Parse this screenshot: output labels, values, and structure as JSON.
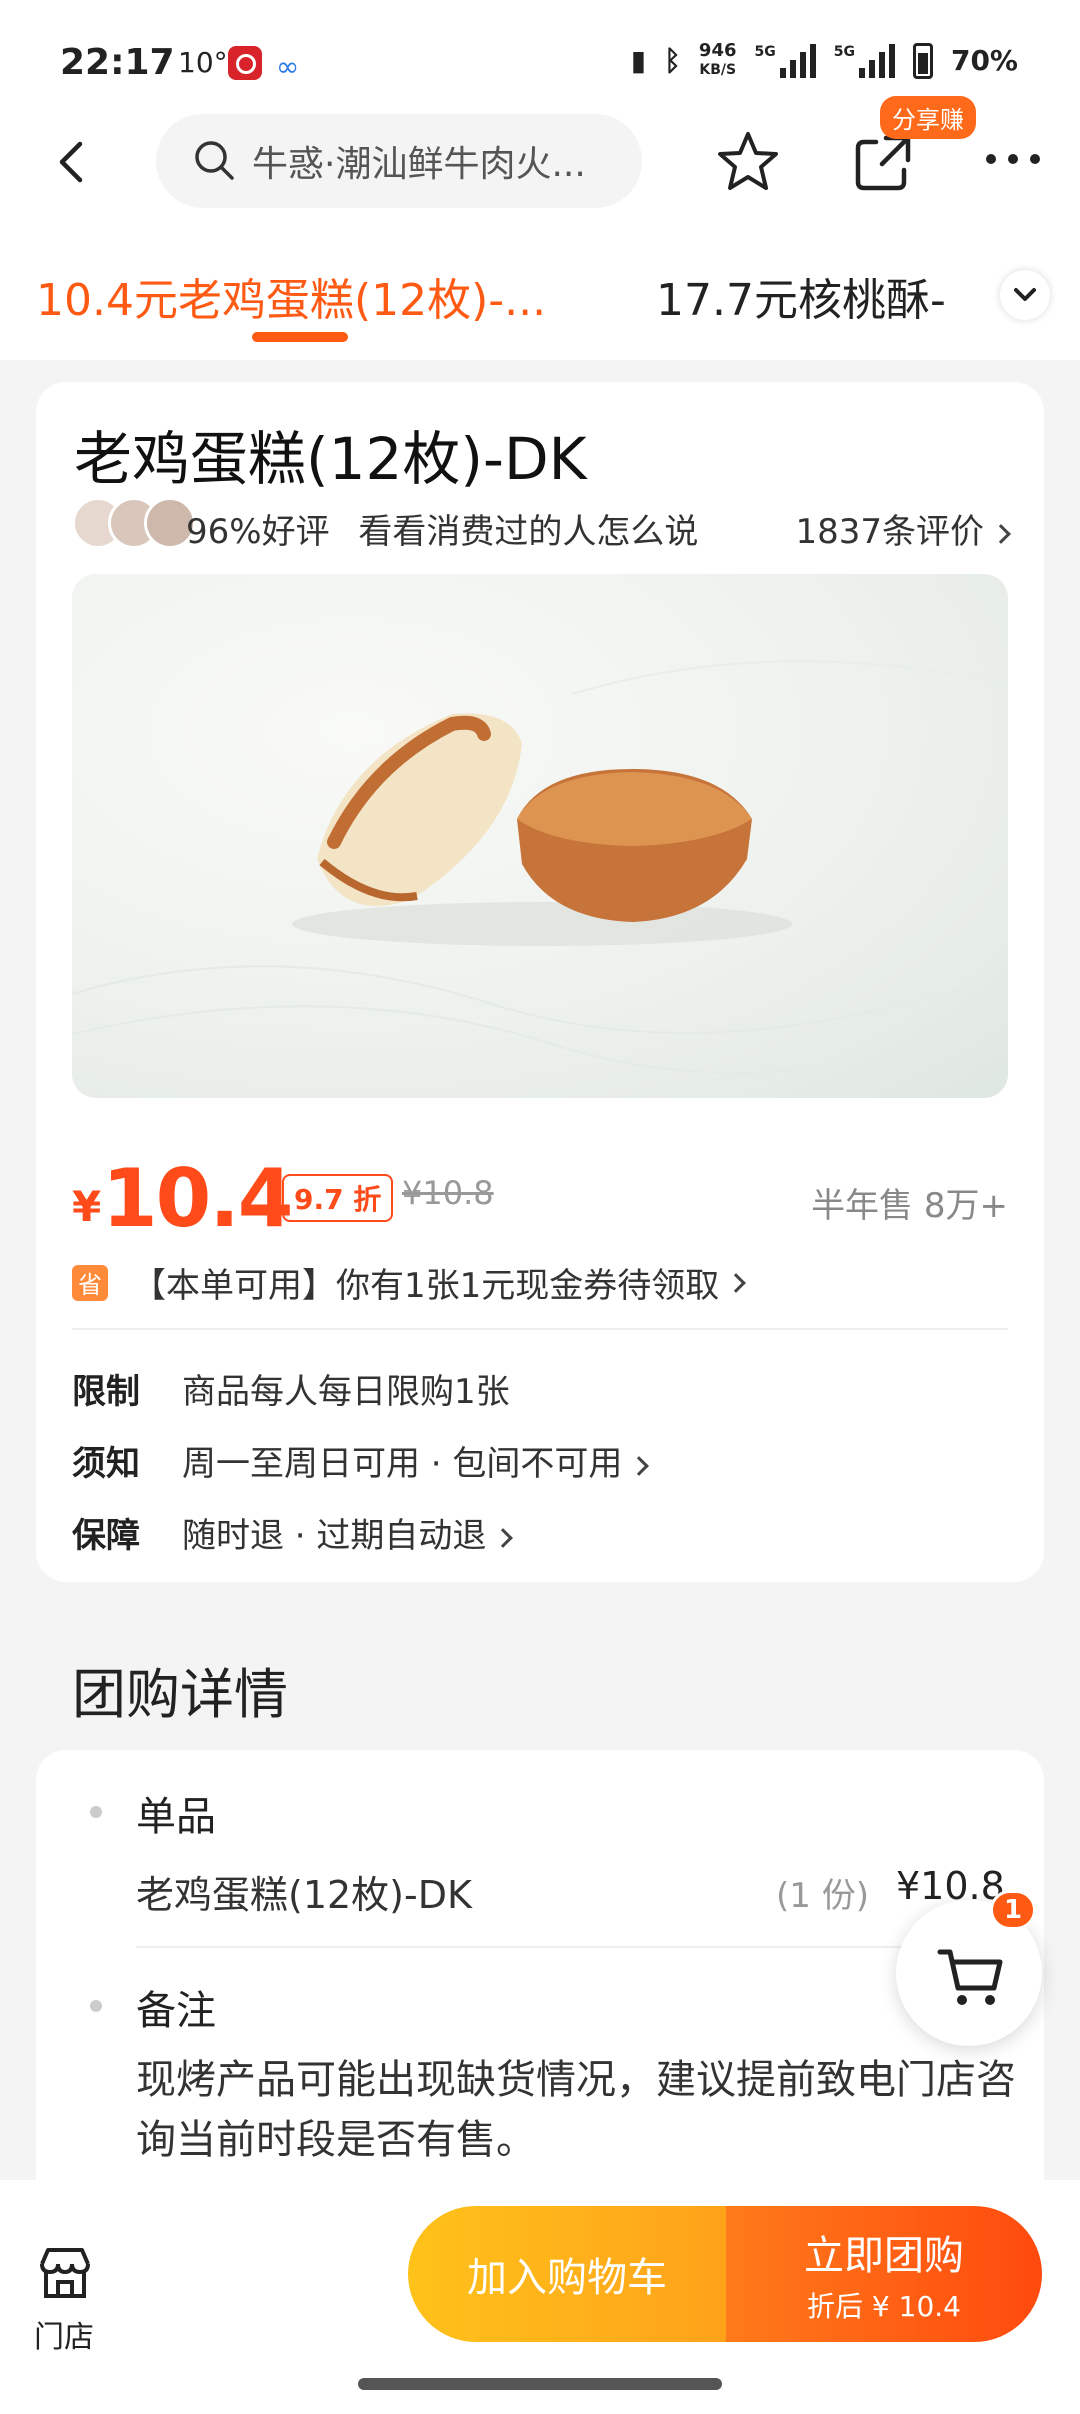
{
  "status_bar": {
    "time": "22:17",
    "temperature": "10°",
    "net_speed_value": "946",
    "net_speed_unit": "KB/S",
    "network": "5G",
    "battery": "70%"
  },
  "header": {
    "search_text": "牛惑·潮汕鲜牛肉火...",
    "share_badge": "分享赚"
  },
  "tabs": [
    {
      "label": "10.4元老鸡蛋糕(12枚)-...",
      "active": true
    },
    {
      "label": "17.7元核桃酥-",
      "active": false
    }
  ],
  "product": {
    "title": "老鸡蛋糕(12枚)-DK",
    "rating": "96%好评",
    "rating_prompt": "看看消费过的人怎么说",
    "reviews": "1837条评价",
    "price_symbol": "¥",
    "price": "10.4",
    "discount": "9.7 折",
    "original_price": "¥10.8",
    "sold": "半年售 8万+",
    "coupon_icon": "省",
    "coupon_text": "【本单可用】你有1张1元现金券待领取",
    "info": [
      {
        "key": "限制",
        "value": "商品每人每日限购1张"
      },
      {
        "key": "须知",
        "value": "周一至周日可用 · 包间不可用"
      },
      {
        "key": "保障",
        "value": "随时退 · 过期自动退"
      }
    ]
  },
  "details": {
    "section_title": "团购详情",
    "item_label": "单品",
    "item_name": "老鸡蛋糕(12枚)-DK",
    "item_qty": "(1 份)",
    "item_price": "¥10.8",
    "remark_label": "备注",
    "remark_text": "现烤产品可能出现缺货情况，建议提前致电门店咨询当前时段是否有售。"
  },
  "cart_float": {
    "count": "1"
  },
  "bottom_bar": {
    "store_label": "门店",
    "add_cart": "加入购物车",
    "buy_now": "立即团购",
    "buy_sub": "折后 ¥ 10.4"
  },
  "colors": {
    "accent": "#ff5a13",
    "price": "#ff4a1a",
    "cart_btn": "#ffb21a",
    "buy_btn": "#ff5a13"
  }
}
